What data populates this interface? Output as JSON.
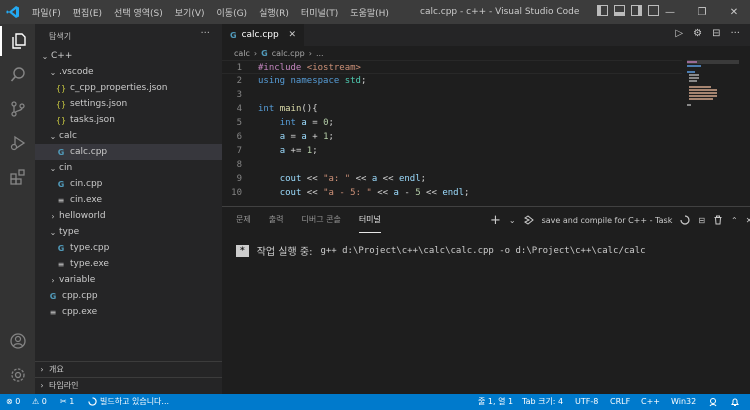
{
  "titlebar": {
    "menu": [
      "파일(F)",
      "편집(E)",
      "선택 영역(S)",
      "보기(V)",
      "이동(G)",
      "실행(R)",
      "터미널(T)",
      "도움말(H)"
    ],
    "title": "calc.cpp - c++ - Visual Studio Code",
    "minimize": "—",
    "restore": "❐",
    "close": "✕"
  },
  "activity": {
    "icons": [
      "files-icon",
      "search-icon",
      "source-control-icon",
      "run-debug-icon",
      "extensions-icon"
    ],
    "bottom_icons": [
      "account-icon",
      "settings-gear-icon"
    ]
  },
  "sidebar": {
    "title": "탐색기",
    "more": "···",
    "root": "C++",
    "tree": [
      {
        "label": "C++",
        "indent": 0,
        "kind": "folder-open"
      },
      {
        "label": ".vscode",
        "indent": 1,
        "kind": "folder-open"
      },
      {
        "label": "c_cpp_properties.json",
        "indent": 2,
        "kind": "json"
      },
      {
        "label": "settings.json",
        "indent": 2,
        "kind": "json"
      },
      {
        "label": "tasks.json",
        "indent": 2,
        "kind": "json"
      },
      {
        "label": "calc",
        "indent": 1,
        "kind": "folder-open"
      },
      {
        "label": "calc.cpp",
        "indent": 2,
        "kind": "cpp",
        "selected": true
      },
      {
        "label": "cin",
        "indent": 1,
        "kind": "folder-open"
      },
      {
        "label": "cin.cpp",
        "indent": 2,
        "kind": "cpp"
      },
      {
        "label": "cin.exe",
        "indent": 2,
        "kind": "exe"
      },
      {
        "label": "helloworld",
        "indent": 1,
        "kind": "folder-closed"
      },
      {
        "label": "type",
        "indent": 1,
        "kind": "folder-open"
      },
      {
        "label": "type.cpp",
        "indent": 2,
        "kind": "cpp"
      },
      {
        "label": "type.exe",
        "indent": 2,
        "kind": "exe"
      },
      {
        "label": "variable",
        "indent": 1,
        "kind": "folder-closed"
      },
      {
        "label": "cpp.cpp",
        "indent": 1,
        "kind": "cpp"
      },
      {
        "label": "cpp.exe",
        "indent": 1,
        "kind": "exe"
      }
    ],
    "outline": "개요",
    "timeline": "타임라인"
  },
  "editor": {
    "tab": {
      "label": "calc.cpp",
      "icon": "G",
      "close": "✕"
    },
    "breadcrumb": [
      "calc",
      "›",
      "G",
      "calc.cpp",
      "›",
      "..."
    ],
    "actions": [
      "▷",
      "⚙",
      "⊟",
      "···"
    ],
    "lines": [
      {
        "n": "1",
        "tokens": [
          {
            "t": "#include ",
            "c": "inc"
          },
          {
            "t": "<iostream>",
            "c": "str"
          }
        ],
        "current": true
      },
      {
        "n": "2",
        "tokens": [
          {
            "t": "using ",
            "c": "kw"
          },
          {
            "t": "namespace ",
            "c": "kw"
          },
          {
            "t": "std",
            "c": "ty"
          },
          {
            "t": ";",
            "c": "op"
          }
        ]
      },
      {
        "n": "3",
        "tokens": []
      },
      {
        "n": "4",
        "tokens": [
          {
            "t": "int ",
            "c": "kw"
          },
          {
            "t": "main",
            "c": "fn"
          },
          {
            "t": "(){",
            "c": "op"
          }
        ]
      },
      {
        "n": "5",
        "tokens": [
          {
            "t": "    ",
            "c": "op"
          },
          {
            "t": "int ",
            "c": "kw"
          },
          {
            "t": "a",
            "c": "var"
          },
          {
            "t": " = ",
            "c": "op"
          },
          {
            "t": "0",
            "c": "num"
          },
          {
            "t": ";",
            "c": "op"
          }
        ]
      },
      {
        "n": "6",
        "tokens": [
          {
            "t": "    ",
            "c": "op"
          },
          {
            "t": "a",
            "c": "var"
          },
          {
            "t": " = ",
            "c": "op"
          },
          {
            "t": "a",
            "c": "var"
          },
          {
            "t": " + ",
            "c": "op"
          },
          {
            "t": "1",
            "c": "num"
          },
          {
            "t": ";",
            "c": "op"
          }
        ]
      },
      {
        "n": "7",
        "tokens": [
          {
            "t": "    ",
            "c": "op"
          },
          {
            "t": "a",
            "c": "var"
          },
          {
            "t": " += ",
            "c": "op"
          },
          {
            "t": "1",
            "c": "num"
          },
          {
            "t": ";",
            "c": "op"
          }
        ]
      },
      {
        "n": "8",
        "tokens": []
      },
      {
        "n": "9",
        "tokens": [
          {
            "t": "    ",
            "c": "op"
          },
          {
            "t": "cout",
            "c": "var"
          },
          {
            "t": " << ",
            "c": "op"
          },
          {
            "t": "\"a: \"",
            "c": "str"
          },
          {
            "t": " << ",
            "c": "op"
          },
          {
            "t": "a",
            "c": "var"
          },
          {
            "t": " << ",
            "c": "op"
          },
          {
            "t": "endl",
            "c": "var"
          },
          {
            "t": ";",
            "c": "op"
          }
        ]
      },
      {
        "n": "10",
        "tokens": [
          {
            "t": "    ",
            "c": "op"
          },
          {
            "t": "cout",
            "c": "var"
          },
          {
            "t": " << ",
            "c": "op"
          },
          {
            "t": "\"a - 5: \"",
            "c": "str"
          },
          {
            "t": " << ",
            "c": "op"
          },
          {
            "t": "a",
            "c": "var"
          },
          {
            "t": " - ",
            "c": "op"
          },
          {
            "t": "5",
            "c": "num"
          },
          {
            "t": " << ",
            "c": "op"
          },
          {
            "t": "endl",
            "c": "var"
          },
          {
            "t": ";",
            "c": "op"
          }
        ]
      }
    ]
  },
  "panel": {
    "tabs": [
      "문제",
      "출력",
      "디버그 콘솔",
      "터미널"
    ],
    "active_tab": 3,
    "add": "+",
    "dropdown": "⌄",
    "task_label": "save and compile for C++ - Task",
    "tool_icons": [
      "⊟",
      "🗑",
      "⌃",
      "✕"
    ],
    "terminal_star": "*",
    "terminal_label": "작업 실행 중:",
    "terminal_cmd": "g++ d:\\Project\\c++\\calc\\calc.cpp -o d:\\Project\\c++\\calc/calc"
  },
  "statusbar": {
    "errors": "⊗ 0",
    "warnings": "⚠ 0",
    "tools": "✂ 1",
    "building": "빌드하고 있습니다...",
    "position": "줄 1, 열 1",
    "tab": "Tab 크기: 4",
    "encoding": "UTF-8",
    "eol": "CRLF",
    "language": "C++",
    "platform": "Win32"
  },
  "colors": {
    "accent": "#007acc",
    "titlebar": "#3c3c3c",
    "activitybar": "#333333",
    "sidebar": "#252526",
    "editor": "#1e1e1e"
  }
}
